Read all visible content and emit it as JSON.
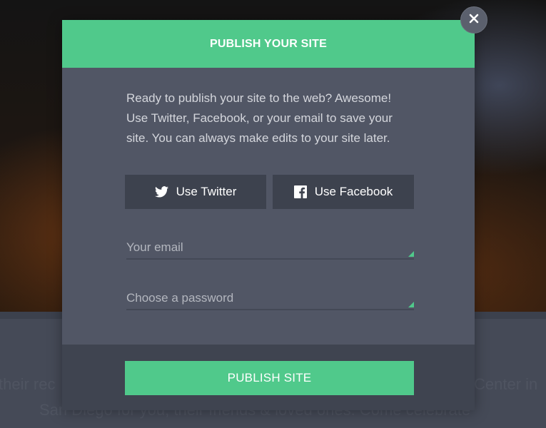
{
  "background": {
    "line1_left": "their rec",
    "line1_right": "Center in",
    "line2": "San Diego for you, their friends & loved ones. Come celebrate"
  },
  "modal": {
    "title": "PUBLISH YOUR SITE",
    "close_icon": "close-icon",
    "intro_text": "Ready to publish your site to the web? Awesome! Use Twitter, Facebook, or your email to save your site. You can always make edits to your site later.",
    "twitter_button": {
      "label": "Use Twitter",
      "icon": "twitter-icon"
    },
    "facebook_button": {
      "label": "Use Facebook",
      "icon": "facebook-icon"
    },
    "email_field": {
      "placeholder": "Your email",
      "value": ""
    },
    "password_field": {
      "placeholder": "Choose a password",
      "value": ""
    },
    "publish_button": {
      "label": "PUBLISH SITE"
    }
  },
  "colors": {
    "accent": "#50c98b",
    "modal_body": "#515665",
    "modal_footer": "#3f4450",
    "social_button": "#3d424e"
  }
}
